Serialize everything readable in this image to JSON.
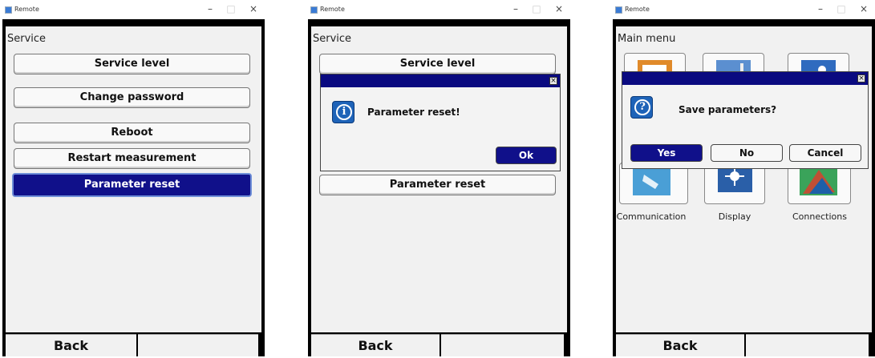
{
  "windows": [
    {
      "title": "Remote",
      "controls": {
        "minimize": "–",
        "maximize": "□",
        "close": "×"
      },
      "screen_title": "Service",
      "menu": [
        {
          "label": "Service level",
          "selected": false
        },
        {
          "label": "Change password",
          "selected": false
        },
        {
          "label": "Reboot",
          "selected": false
        },
        {
          "label": "Restart measurement",
          "selected": false
        },
        {
          "label": "Parameter reset",
          "selected": true
        }
      ],
      "bottom": {
        "back": "Back",
        "right": ""
      }
    },
    {
      "title": "Remote",
      "controls": {
        "minimize": "–",
        "maximize": "□",
        "close": "×"
      },
      "screen_title": "Service",
      "menu": [
        {
          "label": "Service level"
        },
        {
          "label": "Parameter reset"
        }
      ],
      "dialog": {
        "icon": "info-icon",
        "icon_glyph": "i",
        "message": "Parameter reset!",
        "close": "×",
        "button": "Ok"
      },
      "bottom": {
        "back": "Back",
        "right": ""
      }
    },
    {
      "title": "Remote",
      "controls": {
        "minimize": "–",
        "maximize": "□",
        "close": "×"
      },
      "screen_title": "Main menu",
      "tiles": [
        {
          "label": "Communication",
          "icon": "communication-icon",
          "color": "#4a9fd6"
        },
        {
          "label": "Display",
          "icon": "display-icon",
          "color": "#2a5fa8"
        },
        {
          "label": "Connections",
          "icon": "connections-icon",
          "color": "#3aa35a"
        }
      ],
      "dialog": {
        "icon": "question-icon",
        "icon_glyph": "?",
        "message": "Save parameters?",
        "close": "×",
        "buttons": [
          "Yes",
          "No",
          "Cancel"
        ]
      },
      "bottom": {
        "back": "Back",
        "right": ""
      }
    }
  ],
  "colors": {
    "accent": "#10108a",
    "dialog_header": "#0a0a80",
    "frame": "#000000",
    "screen_bg": "#f1f1f1"
  }
}
